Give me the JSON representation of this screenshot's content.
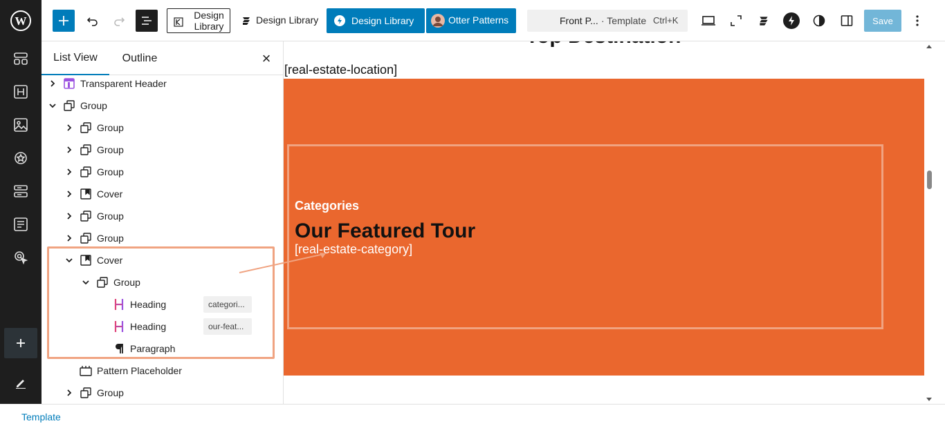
{
  "toolbar": {
    "design_library_outline": "Design Library",
    "design_library_plain": "Design Library",
    "design_library_primary": "Design Library",
    "otter_patterns": "Otter Patterns",
    "doc_title": "Front P...",
    "doc_type": "· Template",
    "shortcut": "Ctrl+K",
    "save": "Save"
  },
  "panel": {
    "tab_list": "List View",
    "tab_outline": "Outline",
    "close": "×"
  },
  "tree": [
    {
      "label": "Transparent Header",
      "icon": "template-part-icon",
      "expanded": false,
      "selected": false
    },
    {
      "label": "Group",
      "icon": "group-icon",
      "expanded": true,
      "selected": false
    },
    {
      "label": "Group",
      "icon": "group-icon",
      "expanded": false,
      "selected": false
    },
    {
      "label": "Group",
      "icon": "group-icon",
      "expanded": false,
      "selected": false
    },
    {
      "label": "Group",
      "icon": "group-icon",
      "expanded": false,
      "selected": false
    },
    {
      "label": "Cover",
      "icon": "cover-icon",
      "expanded": false,
      "selected": false
    },
    {
      "label": "Group",
      "icon": "group-icon",
      "expanded": false,
      "selected": false
    },
    {
      "label": "Group",
      "icon": "group-icon",
      "expanded": false,
      "selected": false
    },
    {
      "label": "Cover",
      "icon": "cover-icon",
      "expanded": true,
      "selected": true
    },
    {
      "label": "Group",
      "icon": "group-icon",
      "expanded": true,
      "selected": true
    },
    {
      "label": "Heading",
      "icon": "heading-icon",
      "anchor": "categori...",
      "selected": true
    },
    {
      "label": "Heading",
      "icon": "heading-icon",
      "anchor": "our-feat...",
      "selected": true
    },
    {
      "label": "Paragraph",
      "icon": "paragraph-icon",
      "selected": true
    },
    {
      "label": "Pattern Placeholder",
      "icon": "pattern-placeholder-icon",
      "selected": false
    },
    {
      "label": "Group",
      "icon": "group-icon",
      "expanded": false,
      "selected": false
    }
  ],
  "canvas": {
    "top_heading_partial": "Top Destination",
    "location_shortcode": "[real-estate-location]",
    "eyebrow": "Categories",
    "heading": "Our Featured Tour",
    "category_shortcode": "[real-estate-category]"
  },
  "colors": {
    "accent": "#007cba",
    "cover_bg": "#ea672e",
    "highlight": "#f0a381",
    "admin_bg": "#1e1e1e"
  },
  "status": {
    "breadcrumb": "Template"
  }
}
